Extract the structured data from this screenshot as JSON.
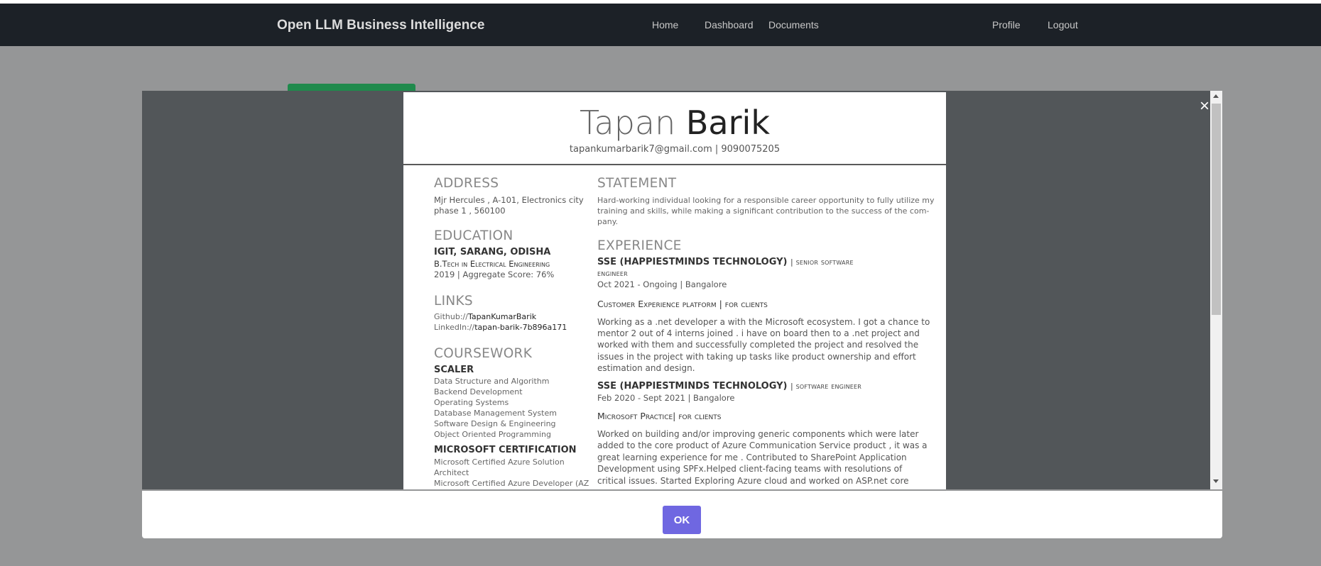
{
  "navbar": {
    "brand": "Open LLM Business Intelligence",
    "links": [
      "Home",
      "Dashboard",
      "Documents"
    ],
    "right_links": [
      "Profile",
      "Logout"
    ]
  },
  "modal": {
    "close": "×",
    "ok_label": "OK"
  },
  "resume": {
    "first_name": "Tapan",
    "last_name": "Barik",
    "contact": "tapankumarbarik7@gmail.com | 9090075205",
    "address": {
      "heading": "ADDRESS",
      "lines": [
        "Mjr Hercules , A-101, Electronics city",
        "phase 1 , 560100"
      ]
    },
    "education": {
      "heading": "EDUCATION",
      "school": "IGIT, SARANG, ODISHA",
      "degree": "B.Tech in Electrical Engineering",
      "score": "2019 | Aggregate Score: 76%"
    },
    "links": {
      "heading": "LINKS",
      "github_label": "Github://",
      "github_value": "TapanKumarBarik",
      "linkedin_label": "LinkedIn://",
      "linkedin_value": "tapan-barik-7b896a171"
    },
    "coursework": {
      "heading": "COURSEWORK",
      "group1": "SCALER",
      "items1": [
        "Data Structure and Algorithm",
        "Backend Development",
        "Operating Systems",
        "Database Management System",
        "Software Design & Engineering",
        "Object Oriented Programming"
      ],
      "group2": "MICROSOFT CERTIFICATION",
      "items2": [
        "Microsoft Certified Azure Solution",
        "Architect",
        "Microsoft Certified Azure Developer (AZ"
      ]
    },
    "statement": {
      "heading": "STATEMENT",
      "lines": [
        "Hard-working individual looking for a responsible career opportunity to fully utilize my",
        "training and skills, while making a significant contribution to the success of the com-",
        "pany."
      ]
    },
    "experience": {
      "heading": "EXPERIENCE",
      "jobs": [
        {
          "company": "SSE (HAPPIESTMINDS TECHNOLOGY)",
          "role_a": "| senior software",
          "role_b": "engineer",
          "dates": "Oct 2021 - Ongoing | Bangalore",
          "project": "Customer Experience platform | for clients",
          "desc": [
            "Working as a .net developer a with the Microsoft ecosystem. I got a chance to",
            "mentor 2 out of 4 interns joined . i have on board then to a .net project and",
            "worked with them and successfully completed the project and resolved the",
            "issues in the project with taking up tasks like product ownership and effort",
            "estimation and design."
          ]
        },
        {
          "company": "SSE (HAPPIESTMINDS TECHNOLOGY)",
          "role_a": "| software engineer",
          "dates": "Feb 2020 - Sept 2021 | Bangalore",
          "project": "Microsoft Practice| for clients",
          "desc": [
            "Worked on building and/or improving generic components which were later",
            "added to the core product of Azure Communication Service product , it was a",
            "great learning experience for me . Contributed to SharePoint Application",
            "Development using SPFx.Helped client-facing teams with resolutions of",
            "critical issues. Started Exploring Azure cloud and worked on ASP.net core"
          ]
        }
      ]
    }
  }
}
